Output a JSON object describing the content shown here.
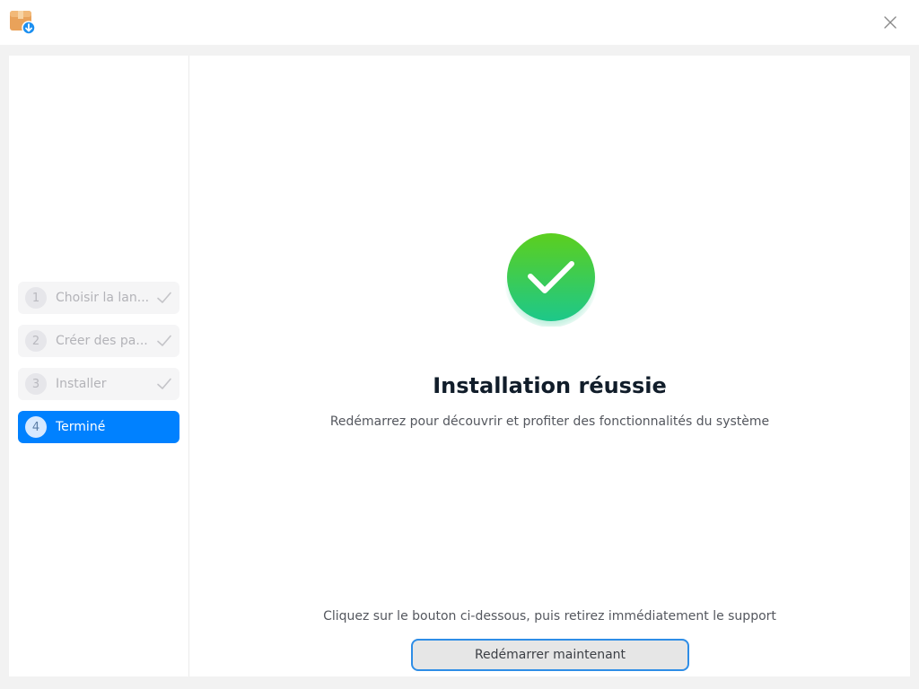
{
  "window": {
    "app_icon": "package-download-icon",
    "close_icon": "close-icon"
  },
  "sidebar": {
    "steps": [
      {
        "number": "1",
        "label": "Choisir la lan...",
        "status": "done"
      },
      {
        "number": "2",
        "label": "Créer des pa...",
        "status": "done"
      },
      {
        "number": "3",
        "label": "Installer",
        "status": "done"
      },
      {
        "number": "4",
        "label": "Terminé",
        "status": "active"
      }
    ]
  },
  "main": {
    "status_icon": "success-check-icon",
    "title": "Installation réussie",
    "subtitle": "Redémarrez pour découvrir et profiter des fonctionnalités du système",
    "hint": "Cliquez sur le bouton ci-dessous, puis retirez immédiatement le support",
    "restart_button": "Redémarrer maintenant"
  },
  "colors": {
    "accent": "#0081ff",
    "success_start": "#5ccf1e",
    "success_end": "#1dc88a",
    "button_border": "#2e8de6"
  }
}
